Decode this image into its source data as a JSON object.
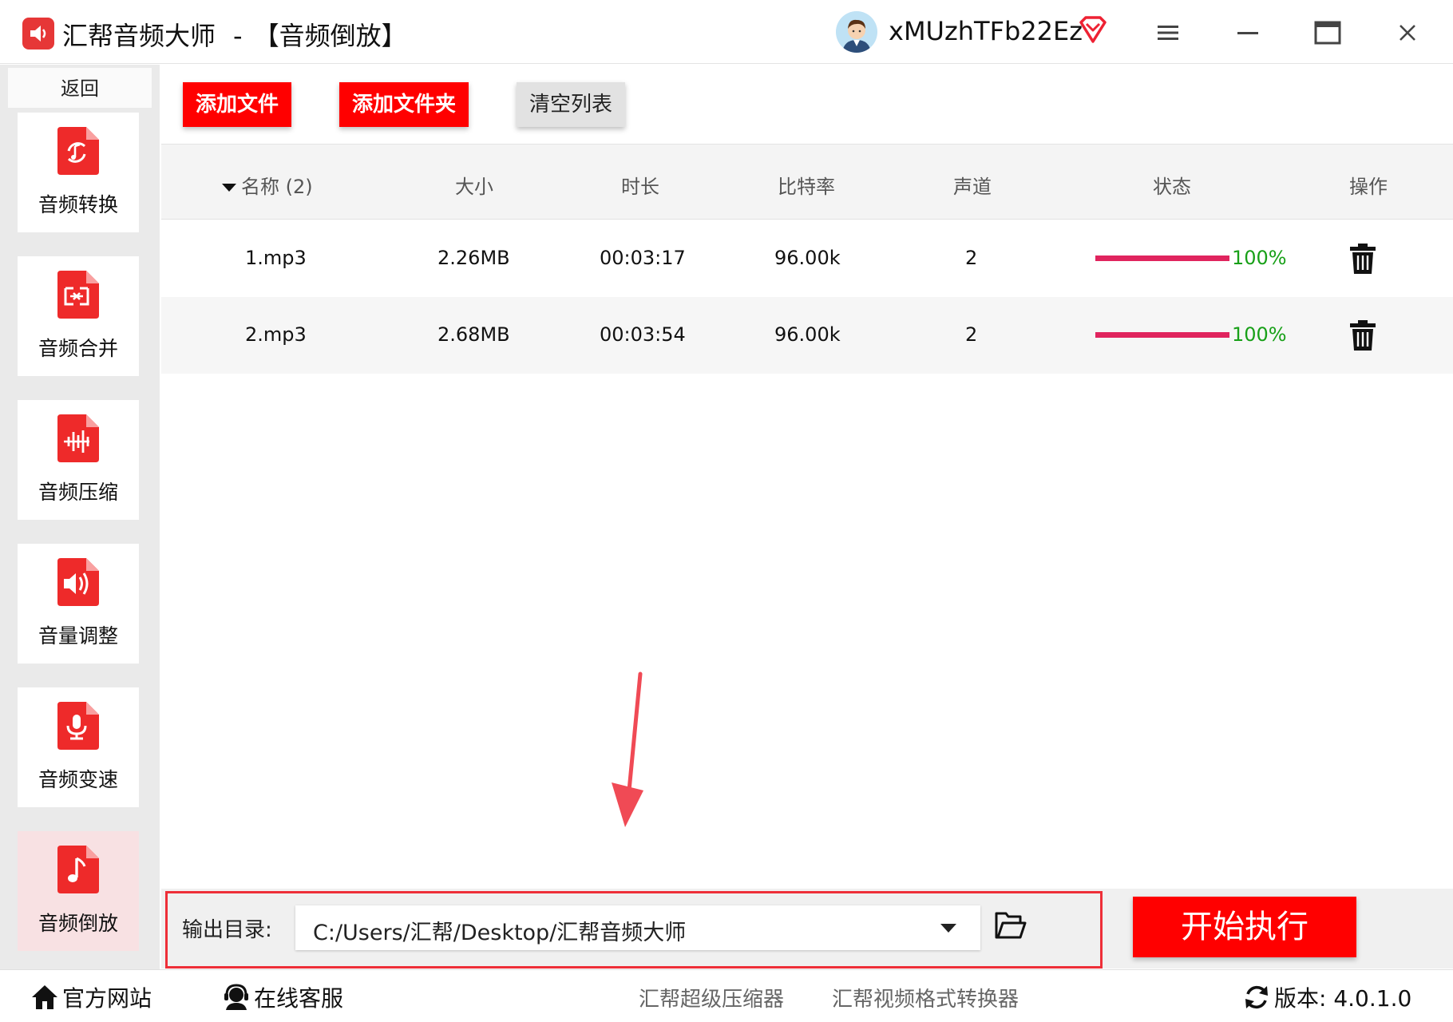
{
  "window": {
    "app_name": "汇帮音频大师",
    "separator": "-",
    "module_title": "【音频倒放】",
    "username": "xMUzhTFb22Ez",
    "icons": [
      "app-logo-icon",
      "avatar",
      "vip-diamond-icon",
      "menu-icon",
      "minimize-icon",
      "maximize-icon",
      "close-icon"
    ],
    "accent_color": "#ff0000"
  },
  "sidebar": {
    "back_label": "返回",
    "items": [
      {
        "label": "音频转换",
        "icon": "audio-convert-icon",
        "active": false
      },
      {
        "label": "音频合并",
        "icon": "audio-merge-icon",
        "active": false
      },
      {
        "label": "音频压缩",
        "icon": "audio-compress-icon",
        "active": false
      },
      {
        "label": "音量调整",
        "icon": "volume-adjust-icon",
        "active": false
      },
      {
        "label": "音频变速",
        "icon": "audio-speed-icon",
        "active": false
      },
      {
        "label": "音频倒放",
        "icon": "audio-reverse-icon",
        "active": true
      }
    ]
  },
  "toolbar": {
    "add_file": "添加文件",
    "add_folder": "添加文件夹",
    "clear_list": "清空列表"
  },
  "table": {
    "columns": {
      "name": "名称 (2)",
      "size": "大小",
      "duration": "时长",
      "bitrate": "比特率",
      "channels": "声道",
      "status": "状态",
      "actions": "操作"
    },
    "rows": [
      {
        "name": "1.mp3",
        "size": "2.26MB",
        "duration": "00:03:17",
        "bitrate": "96.00k",
        "channels": "2",
        "progress": 100,
        "progress_label": "100%"
      },
      {
        "name": "2.mp3",
        "size": "2.68MB",
        "duration": "00:03:54",
        "bitrate": "96.00k",
        "channels": "2",
        "progress": 100,
        "progress_label": "100%"
      }
    ],
    "progress_color": "#e0245e",
    "status_text_color": "#18a018"
  },
  "output": {
    "label": "输出目录:",
    "path": "C:/Users/汇帮/Desktop/汇帮音频大师",
    "start_button": "开始执行"
  },
  "footer": {
    "website": "官方网站",
    "support": "在线客服",
    "link_compressor": "汇帮超级压缩器",
    "link_video_converter": "汇帮视频格式转换器",
    "version": "版本: 4.0.1.0"
  }
}
